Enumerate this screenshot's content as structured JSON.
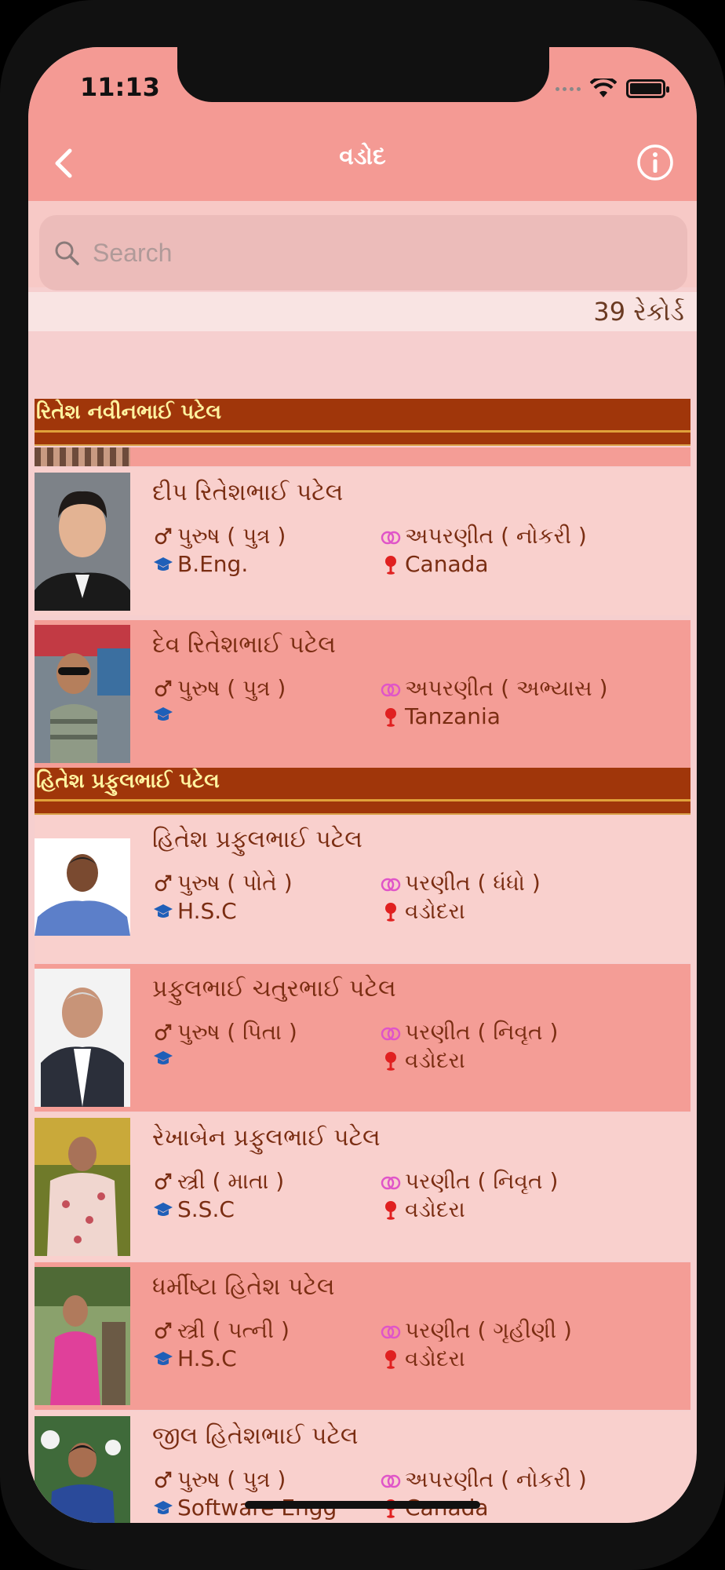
{
  "status_bar": {
    "time": "11:13"
  },
  "nav": {
    "title": "વડોદ"
  },
  "search": {
    "placeholder": "Search"
  },
  "record_count": "39 રેકોર્ડ",
  "sections": [
    {
      "title": "રિતેશ નવીનભાઈ પટેલ",
      "members": [
        {
          "name": "દીપ રિતેશભાઈ પટેલ",
          "gender": "પુરુષ ( પુત્ર )",
          "marital": "અપરણીત ( નોકરી )",
          "education": "B.Eng.",
          "location": "Canada"
        },
        {
          "name": "દેવ રિતેશભાઈ પટેલ",
          "gender": "પુરુષ ( પુત્ર )",
          "marital": "અપરણીત ( અભ્યાસ )",
          "education": "",
          "location": "Tanzania"
        }
      ]
    },
    {
      "title": "હિતેશ પ્રફુલભાઈ પટેલ",
      "members": [
        {
          "name": "હિતેશ પ્રફુલભાઈ પટેલ",
          "gender": "પુરુષ ( પોતે )",
          "marital": "પરણીત ( ધંધો )",
          "education": "H.S.C",
          "location": "વડોદરા"
        },
        {
          "name": "પ્રફુલભાઈ ચતુરભાઈ પટેલ",
          "gender": "પુરુષ ( પિતા )",
          "marital": "પરણીત ( નિવૃત )",
          "education": "",
          "location": "વડોદરા"
        },
        {
          "name": "રેખાબેન પ્રફુલભાઈ પટેલ",
          "gender": "સ્ત્રી ( માતા )",
          "marital": "પરણીત ( નિવૃત )",
          "education": "S.S.C",
          "location": "વડોદરા"
        },
        {
          "name": "ધર્મીષ્ટા હિતેશ પટેલ",
          "gender": "સ્ત્રી ( પત્ની )",
          "marital": "પરણીત ( ગૃહીણી )",
          "education": "H.S.C",
          "location": "વડોદરા"
        },
        {
          "name": "જીલ હિતેશભાઈ પટેલ",
          "gender": "પુરુષ ( પુત્ર )",
          "marital": "અપરણીત ( નોકરી )",
          "education": "Software Engg",
          "location": "Canada"
        }
      ]
    }
  ],
  "colors": {
    "header": "#f49a94",
    "section_header": "#a0360a",
    "row_light": "#f9d0cd",
    "row_dark": "#f49d96",
    "text": "#7a2d12"
  },
  "icons": {
    "back": "chevron-left-icon",
    "info": "info-icon",
    "search": "search-icon",
    "gender": "gender-icon",
    "marital": "rings-icon",
    "education": "graduation-cap-icon",
    "location": "map-pin-icon"
  }
}
